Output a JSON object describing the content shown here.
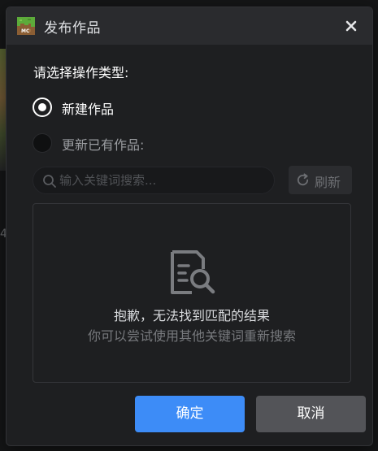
{
  "dialog": {
    "title": "发布作品",
    "app_icon": "minecraft-grass-block-icon",
    "close_icon": "close-icon"
  },
  "operation": {
    "label": "请选择操作类型:",
    "options": [
      {
        "label": "新建作品",
        "selected": true
      },
      {
        "label": "更新已有作品:",
        "selected": false
      }
    ]
  },
  "search": {
    "placeholder": "输入关键词搜索...",
    "value": "",
    "icon": "search-icon"
  },
  "refresh": {
    "label": "刷新",
    "icon": "refresh-icon"
  },
  "results": {
    "empty_icon": "document-search-icon",
    "empty_title": "抱歉，无法找到匹配的结果",
    "empty_subtitle": "你可以尝试使用其他关键词重新搜索"
  },
  "actions": {
    "confirm_label": "确定",
    "cancel_label": "取消"
  },
  "background": {
    "partial_text": "4"
  },
  "colors": {
    "accent": "#3d8cf7",
    "dialog_bg": "#1e1f21",
    "titlebar_bg": "#2a2b2e"
  }
}
